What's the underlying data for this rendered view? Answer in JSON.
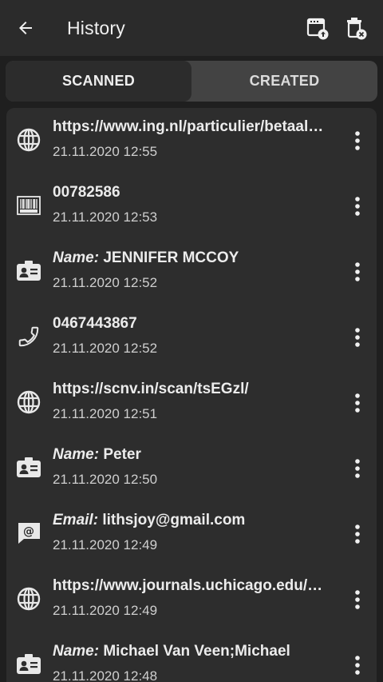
{
  "appbar": {
    "title": "History",
    "back_icon": "arrow-back-icon",
    "export_icon": "export-history-icon",
    "delete_icon": "delete-history-icon"
  },
  "tabs": [
    {
      "label": "SCANNED",
      "active": true
    },
    {
      "label": "CREATED",
      "active": false
    }
  ],
  "items": [
    {
      "icon": "globe-icon",
      "label": "",
      "value": "https://www.ing.nl/particulier/betaal…",
      "time": "21.11.2020 12:55"
    },
    {
      "icon": "barcode-icon",
      "label": "",
      "value": "00782586",
      "time": "21.11.2020 12:53"
    },
    {
      "icon": "contact-card-icon",
      "label": "Name:",
      "value": "JENNIFER MCCOY",
      "time": "21.11.2020 12:52"
    },
    {
      "icon": "phone-icon",
      "label": "",
      "value": "0467443867",
      "time": "21.11.2020 12:52"
    },
    {
      "icon": "globe-icon",
      "label": "",
      "value": "https://scnv.in/scan/tsEGzl/",
      "time": "21.11.2020 12:51"
    },
    {
      "icon": "contact-card-icon",
      "label": "Name:",
      "value": "Peter",
      "time": "21.11.2020 12:50"
    },
    {
      "icon": "email-icon",
      "label": "Email:",
      "value": "lithsjoy@gmail.com",
      "time": "21.11.2020 12:49"
    },
    {
      "icon": "globe-icon",
      "label": "",
      "value": "https://www.journals.uchicago.edu/…",
      "time": "21.11.2020 12:49"
    },
    {
      "icon": "contact-card-icon",
      "label": "Name:",
      "value": "Michael Van Veen;Michael",
      "time": "21.11.2020 12:48"
    }
  ],
  "colors": {
    "background": "#1f1f1f",
    "appbar": "#2b2b2b",
    "card": "#2d2d2d",
    "tab_inactive": "#434343"
  }
}
